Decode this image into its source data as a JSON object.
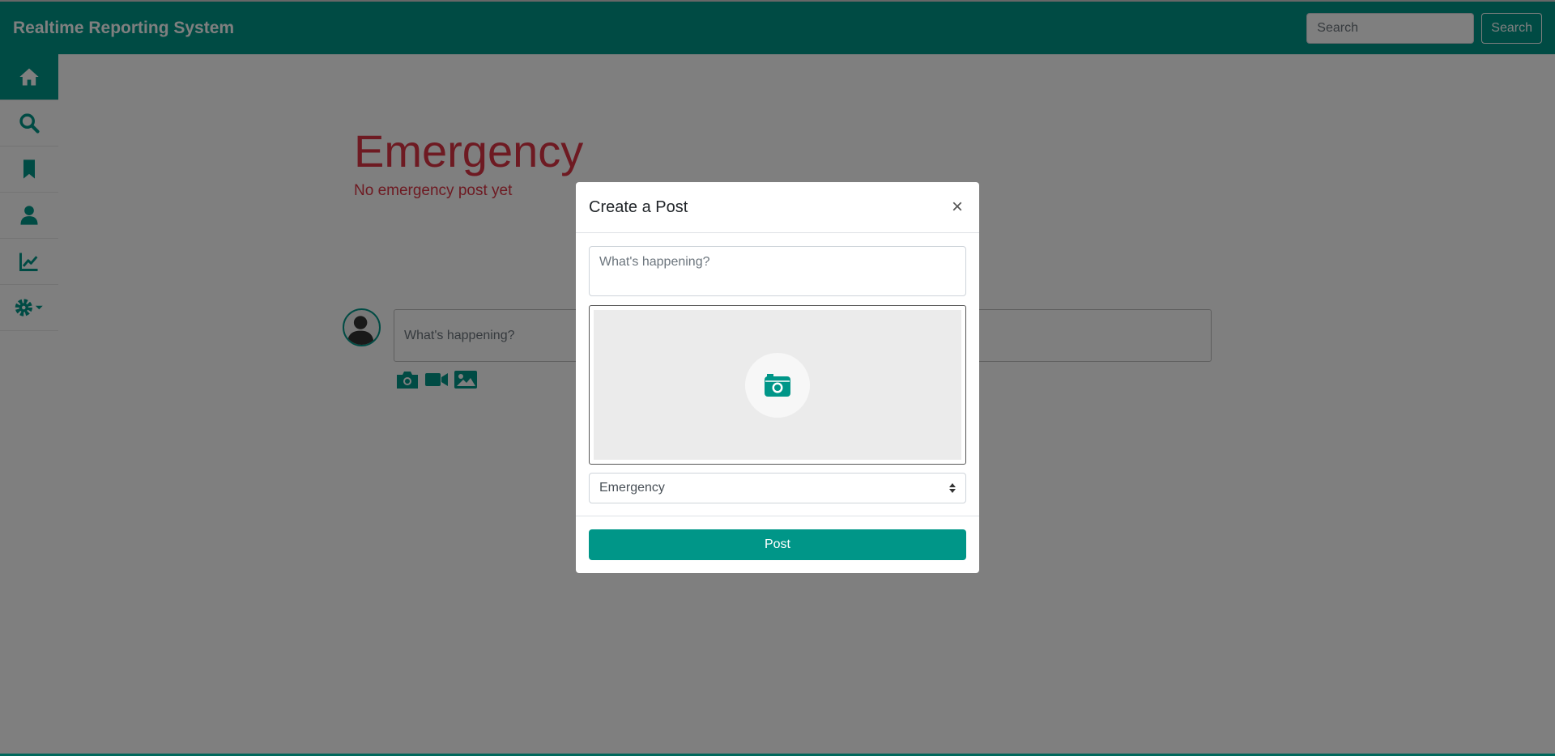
{
  "colors": {
    "primary": "#009688",
    "danger": "#dc3545"
  },
  "navbar": {
    "brand": "Realtime Reporting System",
    "search_placeholder": "Search",
    "search_button": "Search"
  },
  "sidebar": {
    "items": [
      {
        "icon": "home-icon",
        "active": true
      },
      {
        "icon": "search-icon",
        "active": false
      },
      {
        "icon": "bookmark-icon",
        "active": false
      },
      {
        "icon": "user-icon",
        "active": false
      },
      {
        "icon": "chart-line-icon",
        "active": false
      },
      {
        "icon": "gear-dropdown-icon",
        "active": false
      }
    ]
  },
  "emergency": {
    "title": "Emergency",
    "empty_text": "No emergency post yet"
  },
  "composer": {
    "placeholder": "What's happening?",
    "icons": [
      "camera-icon",
      "video-icon",
      "image-icon"
    ]
  },
  "modal": {
    "title": "Create a Post",
    "close": "×",
    "textarea_placeholder": "What's happening?",
    "category_selected": "Emergency",
    "submit": "Post"
  }
}
